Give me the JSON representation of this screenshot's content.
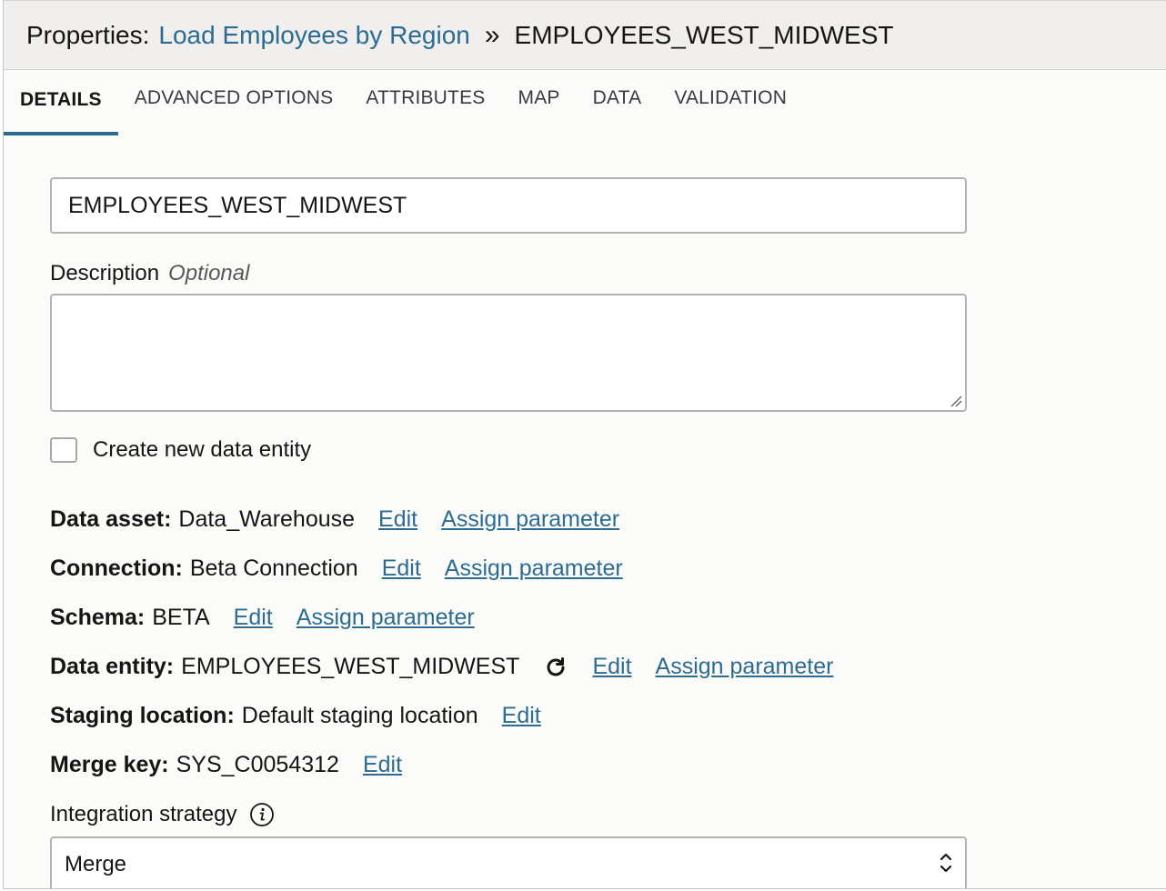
{
  "header": {
    "prefix": "Properties:",
    "flow_link": "Load Employees by Region",
    "separator": "»",
    "current": "EMPLOYEES_WEST_MIDWEST"
  },
  "tabs": [
    {
      "label": "DETAILS",
      "active": true
    },
    {
      "label": "ADVANCED OPTIONS",
      "active": false
    },
    {
      "label": "ATTRIBUTES",
      "active": false
    },
    {
      "label": "MAP",
      "active": false
    },
    {
      "label": "DATA",
      "active": false
    },
    {
      "label": "VALIDATION",
      "active": false
    }
  ],
  "form": {
    "name_value": "EMPLOYEES_WEST_MIDWEST",
    "description_label": "Description",
    "description_optional": "Optional",
    "description_value": "",
    "create_entity_label": "Create new data entity",
    "create_entity_checked": false
  },
  "properties": {
    "data_asset": {
      "key": "Data asset:",
      "value": "Data_Warehouse",
      "edit": "Edit",
      "assign": "Assign parameter"
    },
    "connection": {
      "key": "Connection:",
      "value": "Beta Connection",
      "edit": "Edit",
      "assign": "Assign parameter"
    },
    "schema": {
      "key": "Schema:",
      "value": "BETA",
      "edit": "Edit",
      "assign": "Assign parameter"
    },
    "data_entity": {
      "key": "Data entity:",
      "value": "EMPLOYEES_WEST_MIDWEST",
      "edit": "Edit",
      "assign": "Assign parameter",
      "icon": "refresh-icon"
    },
    "staging_location": {
      "key": "Staging location:",
      "value": "Default staging location",
      "edit": "Edit"
    },
    "merge_key": {
      "key": "Merge key:",
      "value": "SYS_C0054312",
      "edit": "Edit"
    }
  },
  "integration": {
    "label": "Integration strategy",
    "info_icon": "info-icon",
    "selected": "Merge"
  },
  "colors": {
    "link": "#2c6b92",
    "active_tab_underline": "#2c6b92",
    "header_bg": "#f1efed"
  }
}
